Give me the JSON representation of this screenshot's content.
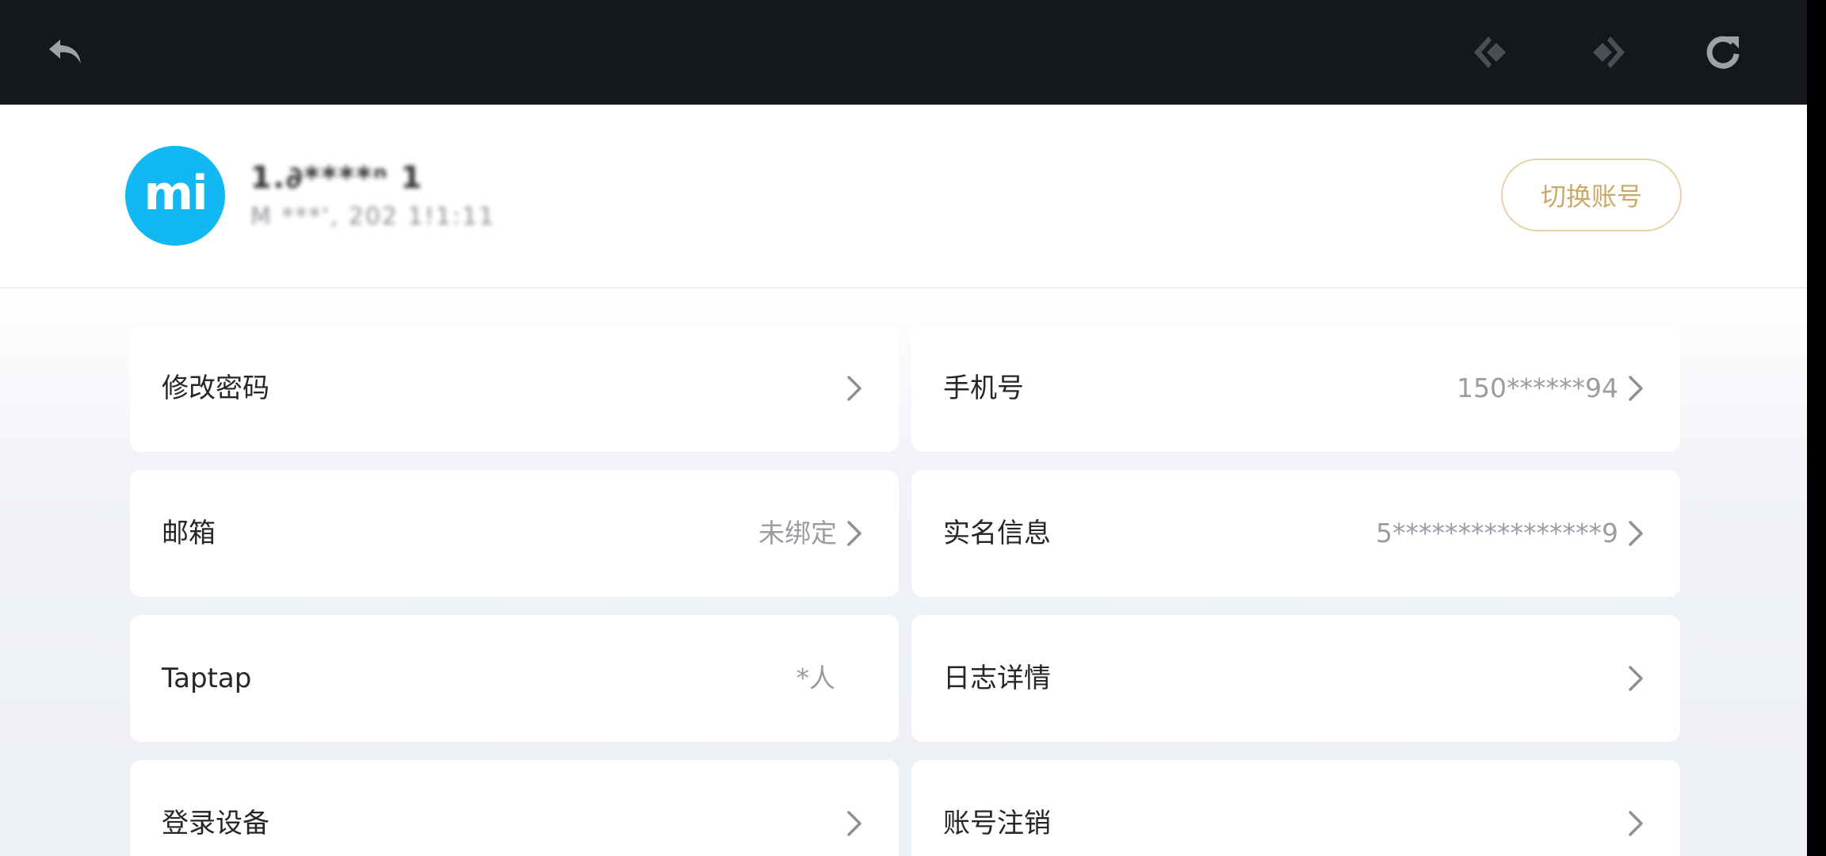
{
  "profile": {
    "avatar_text": "mi",
    "username": "1.∂****ⁿ 1",
    "info": "M ***', 202 1!1:11",
    "switch_label": "切换账号"
  },
  "items": {
    "change_password": {
      "label": "修改密码",
      "value": ""
    },
    "phone": {
      "label": "手机号",
      "value": "150******94"
    },
    "email": {
      "label": "邮箱",
      "value": "未绑定"
    },
    "real_name": {
      "label": "实名信息",
      "value": "5****************9"
    },
    "taptap": {
      "label": "Taptap",
      "value": "*人"
    },
    "log_details": {
      "label": "日志详情",
      "value": ""
    },
    "login_devices": {
      "label": "登录设备",
      "value": ""
    },
    "account_cancel": {
      "label": "账号注销",
      "value": ""
    }
  },
  "icons": {
    "back": "back-arrow-icon",
    "prev": "prev-diamond-icon",
    "next": "next-diamond-icon",
    "refresh": "refresh-icon",
    "chevron": "chevron-right-icon"
  },
  "colors": {
    "toolbar": "#14171b",
    "avatar": "#12b8f2",
    "switch_border": "#e4d3a8",
    "switch_text": "#c9a968",
    "label_text": "#24262a",
    "value_text": "#9a9ca2"
  }
}
